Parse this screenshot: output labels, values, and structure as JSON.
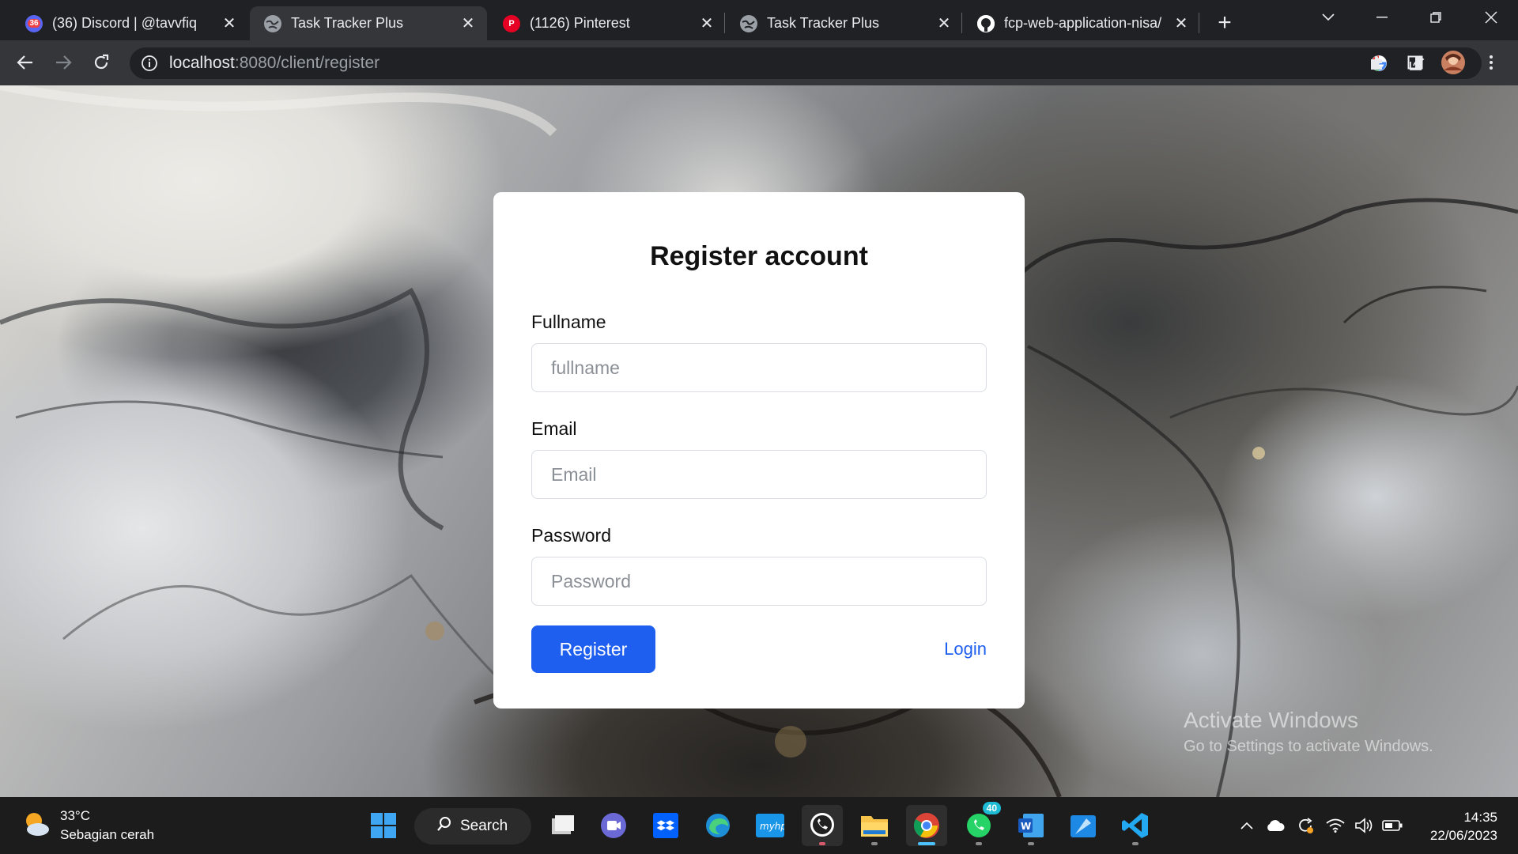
{
  "browser": {
    "tabs": [
      {
        "title": "(36) Discord | @tavvfiq",
        "favicon": "discord-icon",
        "badge": "36"
      },
      {
        "title": "Task Tracker Plus",
        "favicon": "globe-icon",
        "active": true
      },
      {
        "title": "(1126) Pinterest",
        "favicon": "pinterest-icon"
      },
      {
        "title": "Task Tracker Plus",
        "favicon": "globe-icon"
      },
      {
        "title": "fcp-web-application-nisa/",
        "favicon": "github-icon"
      }
    ],
    "address": {
      "host": "localhost",
      "path": ":8080/client/register"
    }
  },
  "form": {
    "title": "Register account",
    "fullname_label": "Fullname",
    "fullname_placeholder": "fullname",
    "email_label": "Email",
    "email_placeholder": "Email",
    "password_label": "Password",
    "password_placeholder": "Password",
    "register_label": "Register",
    "login_label": "Login"
  },
  "watermark": {
    "line1": "Activate Windows",
    "line2": "Go to Settings to activate Windows."
  },
  "taskbar": {
    "weather_temp": "33°C",
    "weather_condition": "Sebagian cerah",
    "search_label": "Search",
    "whatsapp_badge": "40",
    "time": "14:35",
    "date": "22/06/2023"
  },
  "colors": {
    "accent": "#1f5ff0",
    "card": "#ffffff",
    "chrome_dark": "#202124",
    "chrome_toolbar": "#35363a"
  }
}
